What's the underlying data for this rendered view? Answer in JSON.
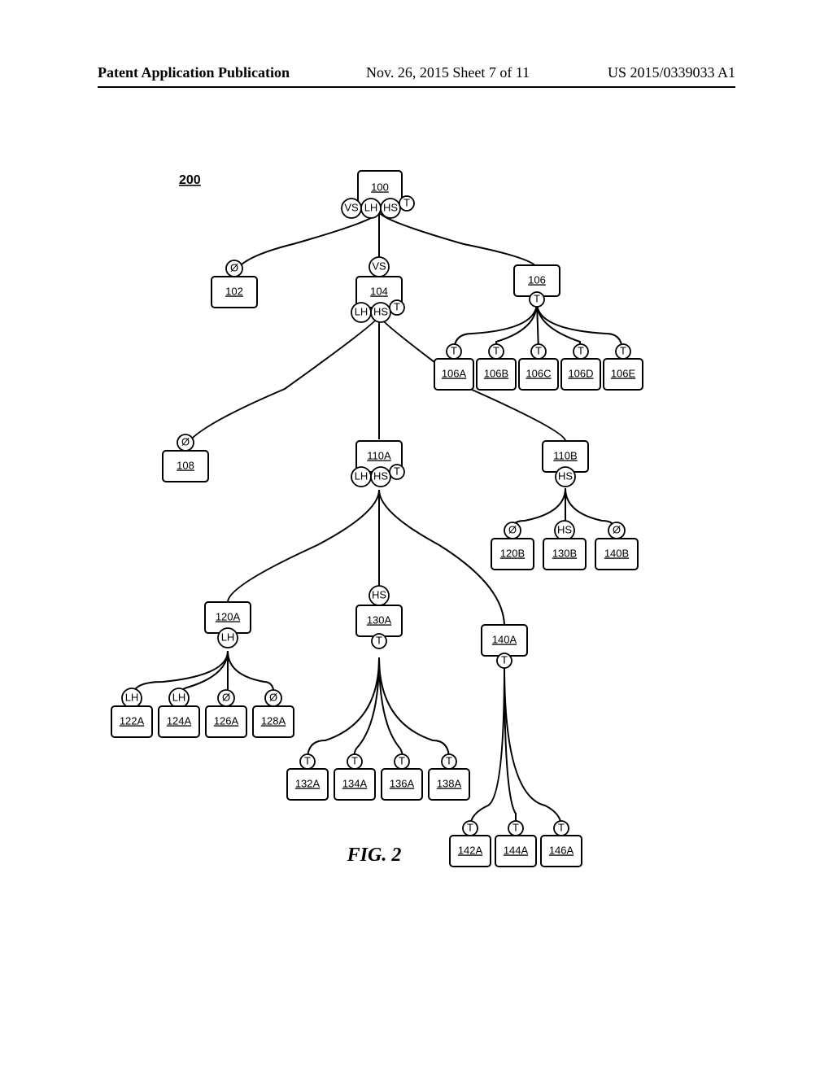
{
  "header": {
    "left": "Patent Application Publication",
    "mid": "Nov. 26, 2015  Sheet 7 of 11",
    "right": "US 2015/0339033 A1"
  },
  "diagramLabel": "200",
  "figure": "FIG. 2",
  "tags": {
    "VS": "VS",
    "LH": "LH",
    "HS": "HS",
    "T": "T",
    "EMPTY": "Ø"
  },
  "nodes": {
    "n100": "100",
    "n102": "102",
    "n104": "104",
    "n106": "106",
    "n106A": "106A",
    "n106B": "106B",
    "n106C": "106C",
    "n106D": "106D",
    "n106E": "106E",
    "n108": "108",
    "n110A": "110A",
    "n110B": "110B",
    "n120A": "120A",
    "n120B": "120B",
    "n130A": "130A",
    "n130B": "130B",
    "n140A": "140A",
    "n140B": "140B",
    "n122A": "122A",
    "n124A": "124A",
    "n126A": "126A",
    "n128A": "128A",
    "n132A": "132A",
    "n134A": "134A",
    "n136A": "136A",
    "n138A": "138A",
    "n142A": "142A",
    "n144A": "144A",
    "n146A": "146A"
  }
}
